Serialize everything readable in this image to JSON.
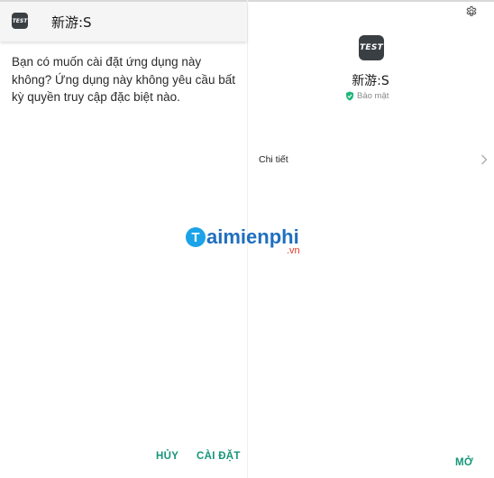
{
  "installer": {
    "app_name": "新游:S",
    "icon_label": "TEST",
    "prompt": "Bạn có muốn cài đặt ứng dụng này không? Ứng dụng này không yêu cầu bất kỳ quyền truy cập đặc biệt nào.",
    "cancel_label": "HỦY",
    "install_label": "CÀI ĐẶT"
  },
  "app_info": {
    "app_name": "新游:S",
    "icon_label": "TEST",
    "security_label": "Bảo mật",
    "details_label": "Chi tiết",
    "open_label": "MỞ"
  },
  "watermark": {
    "initial": "T",
    "text": "aimienphi",
    "sub": ".vn"
  },
  "colors": {
    "accent": "#159579",
    "icon_bg": "#3a3f44",
    "shield": "#1fb67a"
  },
  "icons": [
    "settings-gear-icon",
    "shield-check-icon",
    "chevron-right-icon"
  ]
}
